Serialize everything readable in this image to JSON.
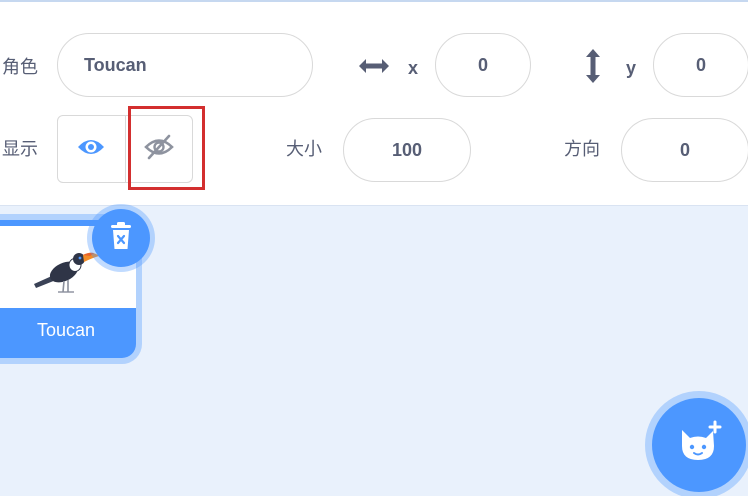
{
  "sprite_info": {
    "sprite_label": "角色",
    "sprite_name": "Toucan",
    "x_label": "x",
    "x_value": "0",
    "y_label": "y",
    "y_value": "0",
    "show_label": "显示",
    "size_label": "大小",
    "size_value": "100",
    "direction_label": "方向",
    "direction_value": "0"
  },
  "sprite_list": {
    "items": [
      {
        "name": "Toucan",
        "selected": true
      }
    ]
  },
  "icons": {
    "x_axis": "horizontal-arrows-icon",
    "y_axis": "vertical-arrows-icon",
    "show": "eye-icon",
    "hide": "eye-slash-icon",
    "delete": "trash-icon",
    "add_sprite": "cat-plus-icon"
  },
  "colors": {
    "accent": "#4c97ff",
    "highlight": "#d32f2f",
    "text": "#575e75",
    "background": "#e9f1fc"
  }
}
